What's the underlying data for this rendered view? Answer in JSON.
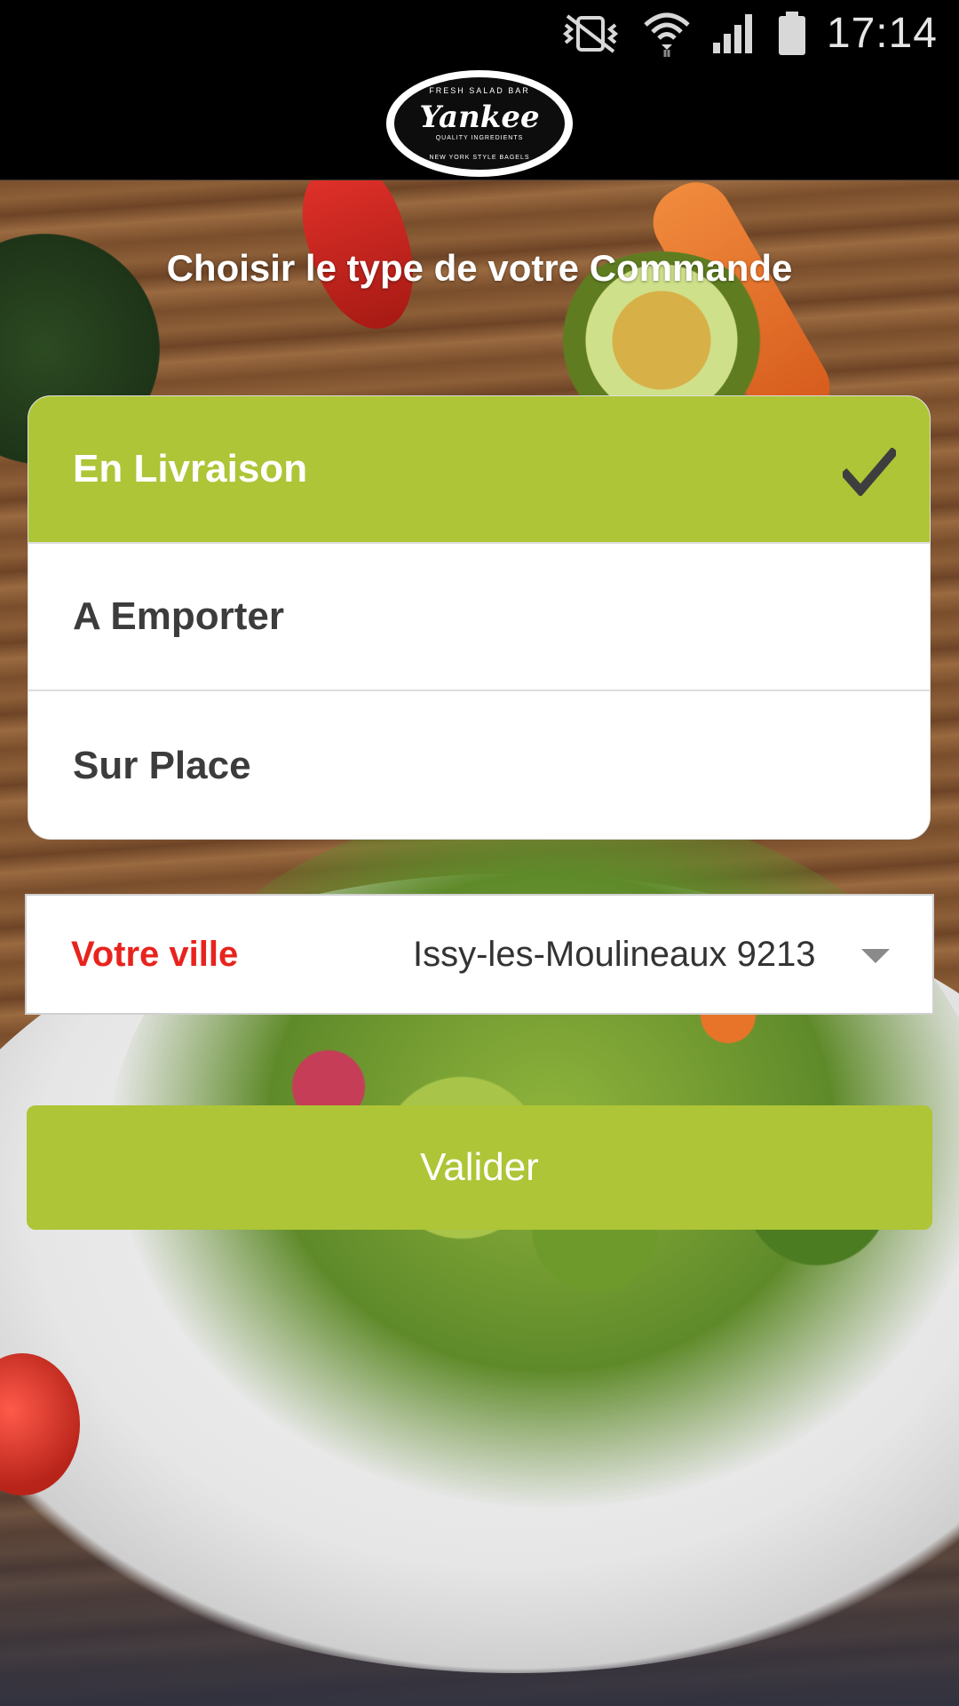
{
  "status_bar": {
    "time": "17:14",
    "icons": [
      "vibrate-mute-icon",
      "wifi-icon",
      "signal-icon",
      "battery-icon"
    ]
  },
  "header": {
    "logo": {
      "top_text": "FRESH SALAD BAR",
      "name": "Yankee",
      "sub_text": "QUALITY INGREDIENTS",
      "bottom_text": "NEW YORK STYLE BAGELS"
    }
  },
  "main": {
    "title": "Choisir le type de votre Commande",
    "order_types": [
      {
        "label": "En Livraison",
        "selected": true
      },
      {
        "label": "A Emporter",
        "selected": false
      },
      {
        "label": "Sur Place",
        "selected": false
      }
    ],
    "city": {
      "label": "Votre ville",
      "value": "Issy-les-Moulineaux 9213"
    },
    "validate_label": "Valider"
  },
  "colors": {
    "accent_green": "#adc536",
    "city_label_red": "#e8231d",
    "text_dark": "#3c3c3c"
  }
}
